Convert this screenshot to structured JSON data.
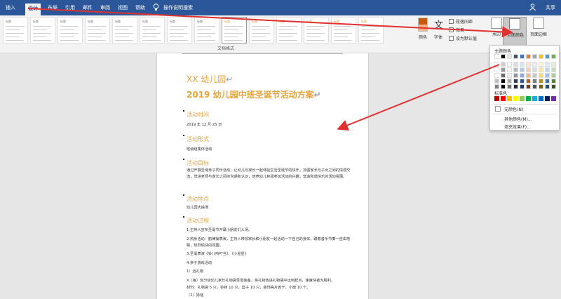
{
  "tabs": [
    "插入",
    "设计",
    "布局",
    "引用",
    "邮件",
    "审阅",
    "视图",
    "帮助"
  ],
  "tell_me": "操作说明搜索",
  "share": "共享",
  "ribbon": {
    "style_titles": [
      "标题",
      "标题",
      "标题",
      "标题",
      "标题",
      "标题",
      "标题",
      "标题",
      "标题",
      "标题",
      "标题",
      "标题",
      "标题",
      "标题"
    ],
    "group_label": "文档格式",
    "colors_label": "颜色",
    "fonts_label": "字体",
    "paragraph_spacing": "段落间距",
    "effects": "效果",
    "set_default": "设为默认值",
    "watermark": "水印",
    "page_color": "页面颜色",
    "page_borders": "页面边框"
  },
  "popup": {
    "theme_colors_label": "主题颜色",
    "standard_colors_label": "标准色",
    "no_color": "无颜色(N)",
    "more_colors": "其他颜色(M)...",
    "fill_effects": "填充效果(F)...",
    "theme_top": [
      "#ffffff",
      "#000000",
      "#e7e6e6",
      "#44546a",
      "#4472c4",
      "#ed7d31",
      "#a5a5a5",
      "#ffc000",
      "#5b9bd5",
      "#70ad47"
    ],
    "standard": [
      "#c00000",
      "#ff0000",
      "#ffc000",
      "#ffff00",
      "#92d050",
      "#00b050",
      "#00b0f0",
      "#0070c0",
      "#002060",
      "#7030a0"
    ]
  },
  "document": {
    "title1": "XX 幼儿园",
    "title2": "2019 幼儿园中班圣诞节活动方案",
    "sections": [
      {
        "heading": "活动时间",
        "lines": [
          "2019 年 12 月 25 日"
        ]
      },
      {
        "heading": "活动形式",
        "lines": [
          "班级组集体活动"
        ]
      },
      {
        "heading": "活动目标",
        "lines": [
          "通过开展圣诞亲子同乐活动，让幼儿与家长一起体验生活圣诞节的快乐，加强家长与子女之间的情感交流，增进老师与家长之间的沟通和认识，培养幼儿积极参加活动的兴趣，营造和谐快乐的活动氛围。"
        ]
      },
      {
        "heading": "活动地点",
        "lines": [
          "幼儿园大操场"
        ]
      },
      {
        "heading": "活动过程",
        "lines": [
          "1.主持人宣布圣诞节开幕小朋友们入场。",
          "2.热身活动：韵律操表演，主持人带领家长和小朋友一起活动一下自己的身体，跟着音乐节奏一自由地跳，热烈愉快的氛围。",
          "3.圣诞表演《铃儿响叮当》、《小星星》",
          "4.亲子游戏活动",
          "1）运礼物",
          "X（每）班分给幼儿家长礼物袋圣诞装备，将礼物放进礼物袋中运到起点，速度快者为胜利。",
          "材料：礼物袋 5 只，铃铛 10 只，篮子 10 只，装饰亮片若干，小旗 10 个。",
          "（2）猜谜"
        ]
      }
    ]
  },
  "accent_color": "#2b579a",
  "heading_color": "#e8a33b",
  "arrow_color": "#e03030"
}
